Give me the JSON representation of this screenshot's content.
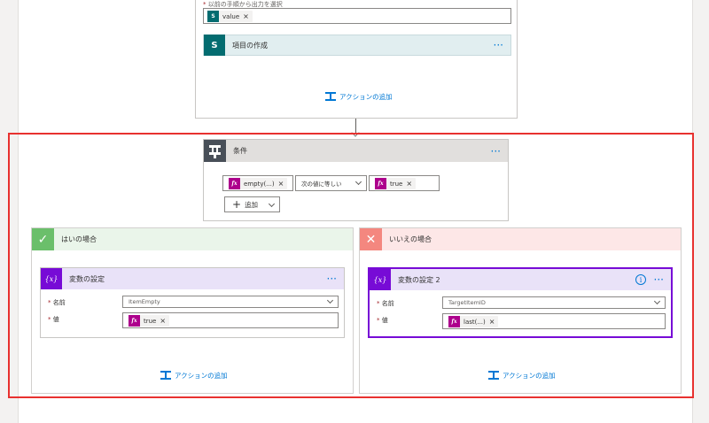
{
  "top_scope": {
    "field_label": "以前の手順から出力を選択",
    "token_label": "value",
    "action_title": "項目の作成",
    "more": "···",
    "add_action": "アクションの追加"
  },
  "condition": {
    "title": "条件",
    "more": "···",
    "left_token": "empty(...)",
    "operator": "次の値に等しい",
    "right_token": "true",
    "add_button": "追加"
  },
  "yes_branch": {
    "title": "はいの場合",
    "header_color": "#eaf5ea",
    "icon_color": "#6bbf6b",
    "card": {
      "title": "変数の設定",
      "more": "···",
      "name_label": "名前",
      "name_value": "ItemEmpty",
      "value_label": "値",
      "value_token": "true"
    },
    "add_action": "アクションの追加"
  },
  "no_branch": {
    "title": "いいえの場合",
    "header_color": "#fde7e7",
    "icon_color": "#f4877f",
    "card": {
      "title": "変数の設定 2",
      "more": "···",
      "name_label": "名前",
      "name_value": "TargetItemID",
      "value_label": "値",
      "value_token": "last(...)",
      "info": "i"
    },
    "add_action": "アクションの追加"
  },
  "colors": {
    "accent": "#0078d4",
    "variable_purple": "#770bd6",
    "expression_pink": "#ad008c",
    "sharepoint_teal": "#036c70",
    "highlight_red": "#e8312f"
  },
  "icons": {
    "sharepoint": "sharepoint-icon",
    "expression": "fx-icon",
    "variable": "variable-icon",
    "condition": "condition-icon",
    "check": "check-icon",
    "cross": "close-icon",
    "add_action": "add-action-icon",
    "info": "info-icon"
  }
}
